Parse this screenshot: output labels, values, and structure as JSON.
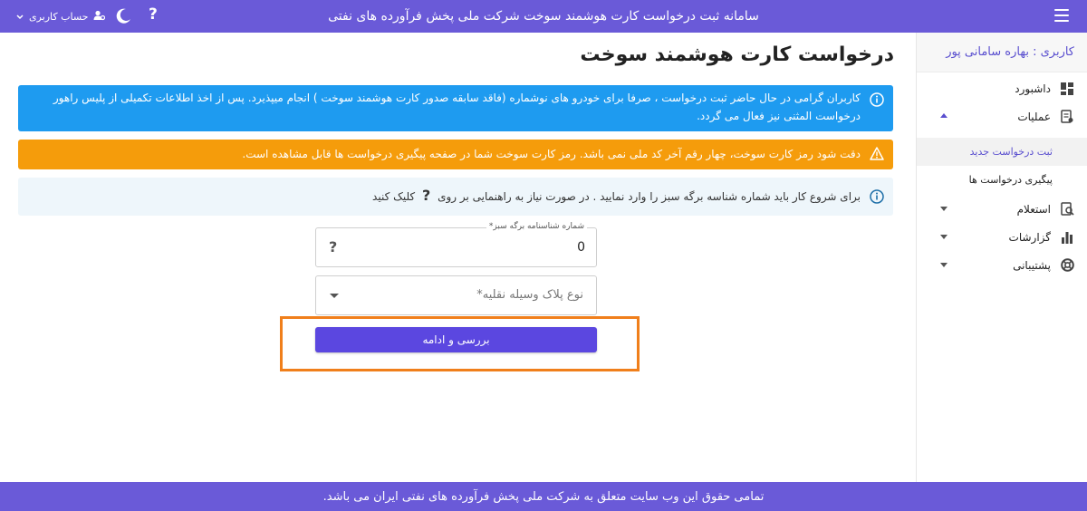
{
  "header": {
    "title": "سامانه ثبت درخواست کارت هوشمند سوخت شرکت ملی پخش فرآورده های نفتی",
    "user_menu_label": "حساب کاربری",
    "help_label": "?"
  },
  "sidebar": {
    "user": "کاربری : بهاره سامانی پور",
    "items": [
      {
        "label": "داشبورد",
        "icon": "dashboard-icon"
      },
      {
        "label": "عملیات",
        "icon": "operations-icon",
        "expanded": true,
        "children": [
          {
            "label": "ثبت درخواست جدید",
            "active": true
          },
          {
            "label": "پیگیری درخواست ها",
            "active": false
          }
        ]
      },
      {
        "label": "استعلام",
        "icon": "inquiry-icon"
      },
      {
        "label": "گزارشات",
        "icon": "reports-icon"
      },
      {
        "label": "پشتیبانی",
        "icon": "support-icon"
      }
    ]
  },
  "main": {
    "title": "درخواست کارت هوشمند سوخت",
    "alerts": {
      "info": "کاربران گرامی در حال حاضر ثبت درخواست ، صرفا برای خودرو های نوشماره (فاقد سابقه صدور کارت هوشمند سوخت ) انجام میپذیرد. پس از اخذ اطلاعات تکمیلی از پلیس راهور درخواست المثنی نیز فعال می گردد.",
      "warning": "دقت شود رمز کارت سوخت، چهار رقم آخر کد ملی نمی باشد. رمز کارت سوخت شما در صفحه پیگیری درخواست ها قابل مشاهده است.",
      "help_before": "برای شروع کار باید شماره شناسه برگه سبز را وارد نمایید . در صورت نیاز به راهنمایی بر روی",
      "help_q": "?",
      "help_after": "کلیک کنید"
    },
    "form": {
      "green_sheet_label": "شماره شناسنامه برگه سبز*",
      "green_sheet_value": "0",
      "green_sheet_help": "?",
      "plate_type_placeholder": "نوع پلاک وسیله نقلیه*",
      "submit_label": "بررسی و ادامه"
    }
  },
  "footer": {
    "text": "تمامی حقوق این وب سایت متعلق به شرکت ملی پخش فرآورده های نفتی ایران می باشد."
  },
  "colors": {
    "brand": "#6a5ad8",
    "info": "#1e9bf0",
    "warning": "#f59c0b",
    "button": "#5b47e0",
    "highlight": "#f07f1b"
  }
}
